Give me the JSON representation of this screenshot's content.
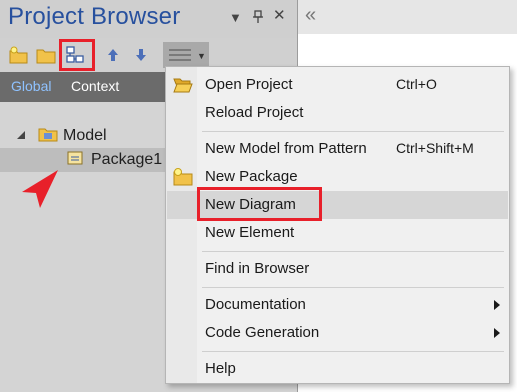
{
  "pane": {
    "title": "Project Browser",
    "title_controls": [
      "▾",
      "ᵖ",
      "×"
    ],
    "toolbar": {
      "icons": [
        "new-model-icon",
        "new-package-icon",
        "new-diagram-icon",
        "move-up-icon",
        "move-down-icon",
        "menu-icon"
      ]
    },
    "tabs": [
      {
        "label": "Global"
      },
      {
        "label": "Context"
      }
    ],
    "tree": {
      "model_label": "Model",
      "package_label": "Package1"
    }
  },
  "right_pane": {
    "collapse_glyph": "«"
  },
  "menu": {
    "items": [
      {
        "label": "Open Project",
        "shortcut": "Ctrl+O"
      },
      {
        "label": "Reload Project"
      },
      {
        "label": "New Model from Pattern",
        "shortcut": "Ctrl+Shift+M"
      },
      {
        "label": "New Package"
      },
      {
        "label": "New Diagram"
      },
      {
        "label": "New Element"
      },
      {
        "label": "Find in Browser"
      },
      {
        "label": "Documentation"
      },
      {
        "label": "Code Generation"
      },
      {
        "label": "Help"
      }
    ]
  },
  "colors": {
    "highlight": "#e8202a",
    "title": "#27509e",
    "tab_active": "#8fc2ff"
  }
}
